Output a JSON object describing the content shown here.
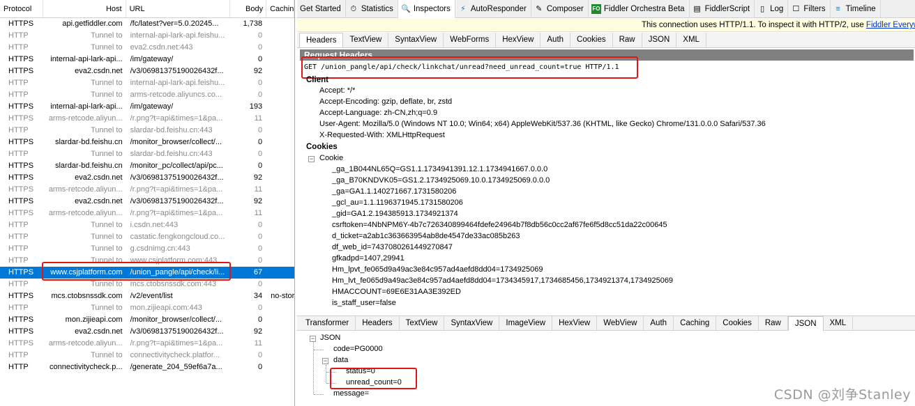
{
  "sessions": {
    "columns": [
      "Protocol",
      "Host",
      "URL",
      "Body",
      "Cachin"
    ],
    "rows": [
      {
        "proto": "HTTPS",
        "host": "api.getfiddler.com",
        "url": "/fc/latest?ver=5.0.20245...",
        "body": "1,738",
        "cache": "",
        "tunnel": false,
        "selected": false
      },
      {
        "proto": "HTTP",
        "host": "Tunnel to",
        "url": "internal-api-lark-api.feishu...",
        "body": "0",
        "cache": "",
        "tunnel": true,
        "selected": false
      },
      {
        "proto": "HTTP",
        "host": "Tunnel to",
        "url": "eva2.csdn.net:443",
        "body": "0",
        "cache": "",
        "tunnel": true,
        "selected": false
      },
      {
        "proto": "HTTPS",
        "host": "internal-api-lark-api...",
        "url": "/im/gateway/",
        "body": "0",
        "cache": "",
        "tunnel": false,
        "selected": false
      },
      {
        "proto": "HTTPS",
        "host": "eva2.csdn.net",
        "url": "/v3/06981375190026432f...",
        "body": "92",
        "cache": "",
        "tunnel": false,
        "selected": false
      },
      {
        "proto": "HTTP",
        "host": "Tunnel to",
        "url": "internal-api-lark-api.feishu...",
        "body": "0",
        "cache": "",
        "tunnel": true,
        "selected": false
      },
      {
        "proto": "HTTP",
        "host": "Tunnel to",
        "url": "arms-retcode.aliyuncs.co...",
        "body": "0",
        "cache": "",
        "tunnel": true,
        "selected": false
      },
      {
        "proto": "HTTPS",
        "host": "internal-api-lark-api...",
        "url": "/im/gateway/",
        "body": "193",
        "cache": "",
        "tunnel": false,
        "selected": false
      },
      {
        "proto": "HTTPS",
        "host": "arms-retcode.aliyun...",
        "url": "/r.png?t=api&times=1&pa...",
        "body": "11",
        "cache": "",
        "tunnel": true,
        "selected": false
      },
      {
        "proto": "HTTP",
        "host": "Tunnel to",
        "url": "slardar-bd.feishu.cn:443",
        "body": "0",
        "cache": "",
        "tunnel": true,
        "selected": false
      },
      {
        "proto": "HTTPS",
        "host": "slardar-bd.feishu.cn",
        "url": "/monitor_browser/collect/...",
        "body": "0",
        "cache": "",
        "tunnel": false,
        "selected": false
      },
      {
        "proto": "HTTP",
        "host": "Tunnel to",
        "url": "slardar-bd.feishu.cn:443",
        "body": "0",
        "cache": "",
        "tunnel": true,
        "selected": false
      },
      {
        "proto": "HTTPS",
        "host": "slardar-bd.feishu.cn",
        "url": "/monitor_pc/collect/api/pc...",
        "body": "0",
        "cache": "",
        "tunnel": false,
        "selected": false
      },
      {
        "proto": "HTTPS",
        "host": "eva2.csdn.net",
        "url": "/v3/06981375190026432f...",
        "body": "92",
        "cache": "",
        "tunnel": false,
        "selected": false
      },
      {
        "proto": "HTTPS",
        "host": "arms-retcode.aliyun...",
        "url": "/r.png?t=api&times=1&pa...",
        "body": "11",
        "cache": "",
        "tunnel": true,
        "selected": false
      },
      {
        "proto": "HTTPS",
        "host": "eva2.csdn.net",
        "url": "/v3/06981375190026432f...",
        "body": "92",
        "cache": "",
        "tunnel": false,
        "selected": false
      },
      {
        "proto": "HTTPS",
        "host": "arms-retcode.aliyun...",
        "url": "/r.png?t=api&times=1&pa...",
        "body": "11",
        "cache": "",
        "tunnel": true,
        "selected": false
      },
      {
        "proto": "HTTP",
        "host": "Tunnel to",
        "url": "i.csdn.net:443",
        "body": "0",
        "cache": "",
        "tunnel": true,
        "selected": false
      },
      {
        "proto": "HTTP",
        "host": "Tunnel to",
        "url": "castatic.fengkongcloud.co...",
        "body": "0",
        "cache": "",
        "tunnel": true,
        "selected": false
      },
      {
        "proto": "HTTP",
        "host": "Tunnel to",
        "url": "g.csdnimg.cn:443",
        "body": "0",
        "cache": "",
        "tunnel": true,
        "selected": false
      },
      {
        "proto": "HTTP",
        "host": "Tunnel to",
        "url": "www.csjplatform.com:443",
        "body": "0",
        "cache": "",
        "tunnel": true,
        "selected": false
      },
      {
        "proto": "HTTPS",
        "host": "www.csjplatform.com",
        "url": "/union_pangle/api/check/li...",
        "body": "67",
        "cache": "",
        "tunnel": false,
        "selected": true
      },
      {
        "proto": "HTTP",
        "host": "Tunnel to",
        "url": "mcs.ctobsnssdk.com:443",
        "body": "0",
        "cache": "",
        "tunnel": true,
        "selected": false
      },
      {
        "proto": "HTTPS",
        "host": "mcs.ctobsnssdk.com",
        "url": "/v2/event/list",
        "body": "34",
        "cache": "no-stor",
        "tunnel": false,
        "selected": false
      },
      {
        "proto": "HTTP",
        "host": "Tunnel to",
        "url": "mon.zijieapi.com:443",
        "body": "0",
        "cache": "",
        "tunnel": true,
        "selected": false
      },
      {
        "proto": "HTTPS",
        "host": "mon.zijieapi.com",
        "url": "/monitor_browser/collect/...",
        "body": "0",
        "cache": "",
        "tunnel": false,
        "selected": false
      },
      {
        "proto": "HTTPS",
        "host": "eva2.csdn.net",
        "url": "/v3/06981375190026432f...",
        "body": "92",
        "cache": "",
        "tunnel": false,
        "selected": false
      },
      {
        "proto": "HTTPS",
        "host": "arms-retcode.aliyun...",
        "url": "/r.png?t=api&times=1&pa...",
        "body": "11",
        "cache": "",
        "tunnel": true,
        "selected": false
      },
      {
        "proto": "HTTP",
        "host": "Tunnel to",
        "url": "connectivitycheck.platfor...",
        "body": "0",
        "cache": "",
        "tunnel": true,
        "selected": false
      },
      {
        "proto": "HTTP",
        "host": "connectivitycheck.p...",
        "url": "/generate_204_59ef6a7a...",
        "body": "0",
        "cache": "",
        "tunnel": false,
        "selected": false
      }
    ]
  },
  "tabs": [
    {
      "label": "Get Started",
      "icon": "none",
      "active": false
    },
    {
      "label": "Statistics",
      "icon": "stopwatch-icon",
      "active": false
    },
    {
      "label": "Inspectors",
      "icon": "magnifier-icon",
      "active": true
    },
    {
      "label": "AutoResponder",
      "icon": "lightning-icon",
      "active": false
    },
    {
      "label": "Composer",
      "icon": "pencil-icon",
      "active": false
    },
    {
      "label": "Fiddler Orchestra Beta",
      "icon": "fo-icon",
      "active": false
    },
    {
      "label": "FiddlerScript",
      "icon": "script-icon",
      "active": false
    },
    {
      "label": "Log",
      "icon": "log-icon",
      "active": false
    },
    {
      "label": "Filters",
      "icon": "checkbox-icon",
      "active": false
    },
    {
      "label": "Timeline",
      "icon": "timeline-icon",
      "active": false
    }
  ],
  "notice": {
    "text": "This connection uses HTTP/1.1. To inspect it with HTTP/2, use ",
    "link": "Fiddler Everywhere"
  },
  "request_tabs": [
    "Headers",
    "TextView",
    "SyntaxView",
    "WebForms",
    "HexView",
    "Auth",
    "Cookies",
    "Raw",
    "JSON",
    "XML"
  ],
  "request": {
    "title": "Request Headers",
    "line": "GET /union_pangle/api/check/linkchat/unread?need_unread_count=true HTTP/1.1",
    "client_label": "Client",
    "client": [
      "Accept: */*",
      "Accept-Encoding: gzip, deflate, br, zstd",
      "Accept-Language: zh-CN,zh;q=0.9",
      "User-Agent: Mozilla/5.0 (Windows NT 10.0; Win64; x64) AppleWebKit/537.36 (KHTML, like Gecko) Chrome/131.0.0.0 Safari/537.36",
      "X-Requested-With: XMLHttpRequest"
    ],
    "cookies_label": "Cookies",
    "cookie_label": "Cookie",
    "cookies": [
      "_ga_1B044NL65Q=GS1.1.1734941391.12.1.1734941667.0.0.0",
      "_ga_B70KNDVK05=GS1.2.1734925069.10.0.1734925069.0.0.0",
      "_ga=GA1.1.140271667.1731580206",
      "_gcl_au=1.1.1196371945.1731580206",
      "_gid=GA1.2.194385913.1734921374",
      "csrftoken=4NbNPM6Y-4b7c726340899464fdefe24964b7f8db56c0cc2af67fe6f5d8cc51da22c00645",
      "d_ticket=a2ab1c363663954ab8de4547de33ac085b263",
      "df_web_id=7437080261449270847",
      "gfkadpd=1407,29941",
      "Hm_lpvt_fe065d9a49ac3e84c957ad4aefd8dd04=1734925069",
      "Hm_lvt_fe065d9a49ac3e84c957ad4aefd8dd04=1734345917,1734685456,1734921374,1734925069",
      "HMACCOUNT=69E6E31AA3E392ED",
      "is_staff_user=false"
    ]
  },
  "response_tabs": [
    "Transformer",
    "Headers",
    "TextView",
    "SyntaxView",
    "ImageView",
    "HexView",
    "WebView",
    "Auth",
    "Caching",
    "Cookies",
    "Raw",
    "JSON",
    "XML"
  ],
  "json_tree": {
    "root": "JSON",
    "code": "code=PG0000",
    "data": "data",
    "status": "status=0",
    "unread_count": "unread_count=0",
    "message": "message="
  },
  "watermark": "CSDN @刘争Stanley",
  "colors": {
    "selection": "#0078d7",
    "highlight_box": "#e01515",
    "notice_bg": "#fffde0"
  }
}
